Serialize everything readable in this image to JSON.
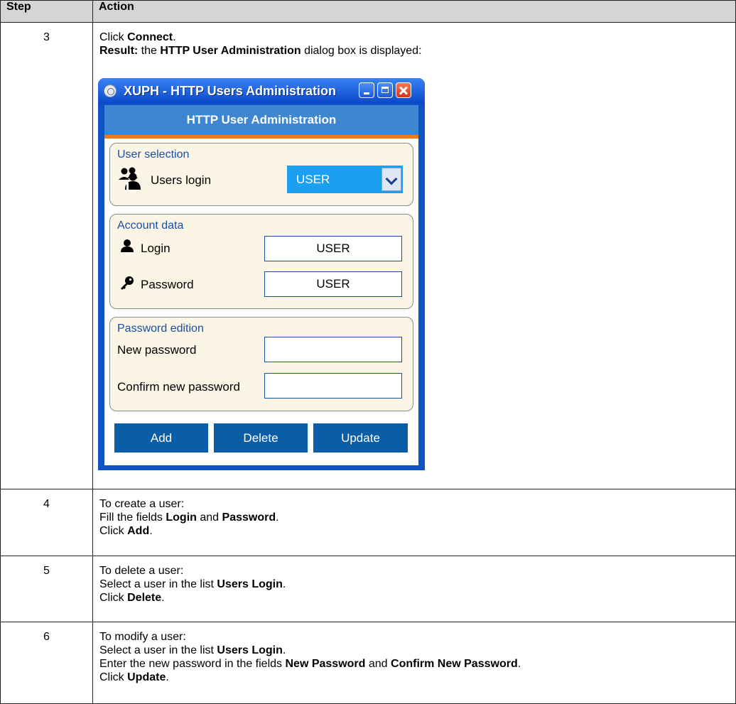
{
  "table": {
    "headers": {
      "step": "Step",
      "action": "Action"
    },
    "rows": [
      {
        "step": "3",
        "lines": [
          [
            {
              "t": "Click ",
              "b": false
            },
            {
              "t": "Connect",
              "b": true
            },
            {
              "t": ".",
              "b": false
            }
          ],
          [
            {
              "t": "Result:",
              "b": true
            },
            {
              "t": " the ",
              "b": false
            },
            {
              "t": "HTTP User Administration",
              "b": true
            },
            {
              "t": " dialog box is displayed:",
              "b": false
            }
          ]
        ]
      },
      {
        "step": "4",
        "lines": [
          [
            {
              "t": "To create a user:",
              "b": false
            }
          ],
          [
            {
              "t": "Fill the fields ",
              "b": false
            },
            {
              "t": "Login",
              "b": true
            },
            {
              "t": " and ",
              "b": false
            },
            {
              "t": "Password",
              "b": true
            },
            {
              "t": ".",
              "b": false
            }
          ],
          [
            {
              "t": "Click ",
              "b": false
            },
            {
              "t": "Add",
              "b": true
            },
            {
              "t": ".",
              "b": false
            }
          ]
        ]
      },
      {
        "step": "5",
        "lines": [
          [
            {
              "t": "To delete a user:",
              "b": false
            }
          ],
          [
            {
              "t": "Select a user in the list ",
              "b": false
            },
            {
              "t": "Users Login",
              "b": true
            },
            {
              "t": ".",
              "b": false
            }
          ],
          [
            {
              "t": "Click ",
              "b": false
            },
            {
              "t": "Delete",
              "b": true
            },
            {
              "t": ".",
              "b": false
            }
          ]
        ]
      },
      {
        "step": "6",
        "lines": [
          [
            {
              "t": "To modify a user:",
              "b": false
            }
          ],
          [
            {
              "t": "Select a user in the list ",
              "b": false
            },
            {
              "t": "Users Login",
              "b": true
            },
            {
              "t": ".",
              "b": false
            }
          ],
          [
            {
              "t": "Enter the new password in the fields ",
              "b": false
            },
            {
              "t": "New Password",
              "b": true
            },
            {
              "t": " and ",
              "b": false
            },
            {
              "t": "Confirm New Password",
              "b": true
            },
            {
              "t": ".",
              "b": false
            }
          ],
          [
            {
              "t": "Click ",
              "b": false
            },
            {
              "t": "Update",
              "b": true
            },
            {
              "t": ".",
              "b": false
            }
          ]
        ]
      }
    ]
  },
  "dialog": {
    "window_title": "XUPH - HTTP Users Administration",
    "header": "HTTP User Administration",
    "user_selection": {
      "title": "User selection",
      "label": "Users login",
      "selected": "USER"
    },
    "account_data": {
      "title": "Account data",
      "login_label": "Login",
      "login_value": "USER",
      "password_label": "Password",
      "password_value": "USER"
    },
    "password_edition": {
      "title": "Password edition",
      "new_label": "New password",
      "new_value": "",
      "confirm_label": "Confirm new password",
      "confirm_value": ""
    },
    "buttons": {
      "add": "Add",
      "delete": "Delete",
      "update": "Update"
    },
    "icons": [
      "app-icon",
      "minimize-icon",
      "maximize-icon",
      "close-icon",
      "users-icon",
      "user-icon",
      "key-icon",
      "chevron-down-icon"
    ],
    "colors": {
      "title_bar": "#0f52c6",
      "header": "#3d86d2",
      "accent_line": "#f07a1a",
      "group_bg": "#fbf5e6",
      "button": "#0a5ea8",
      "select": "#1aa0ee"
    }
  }
}
